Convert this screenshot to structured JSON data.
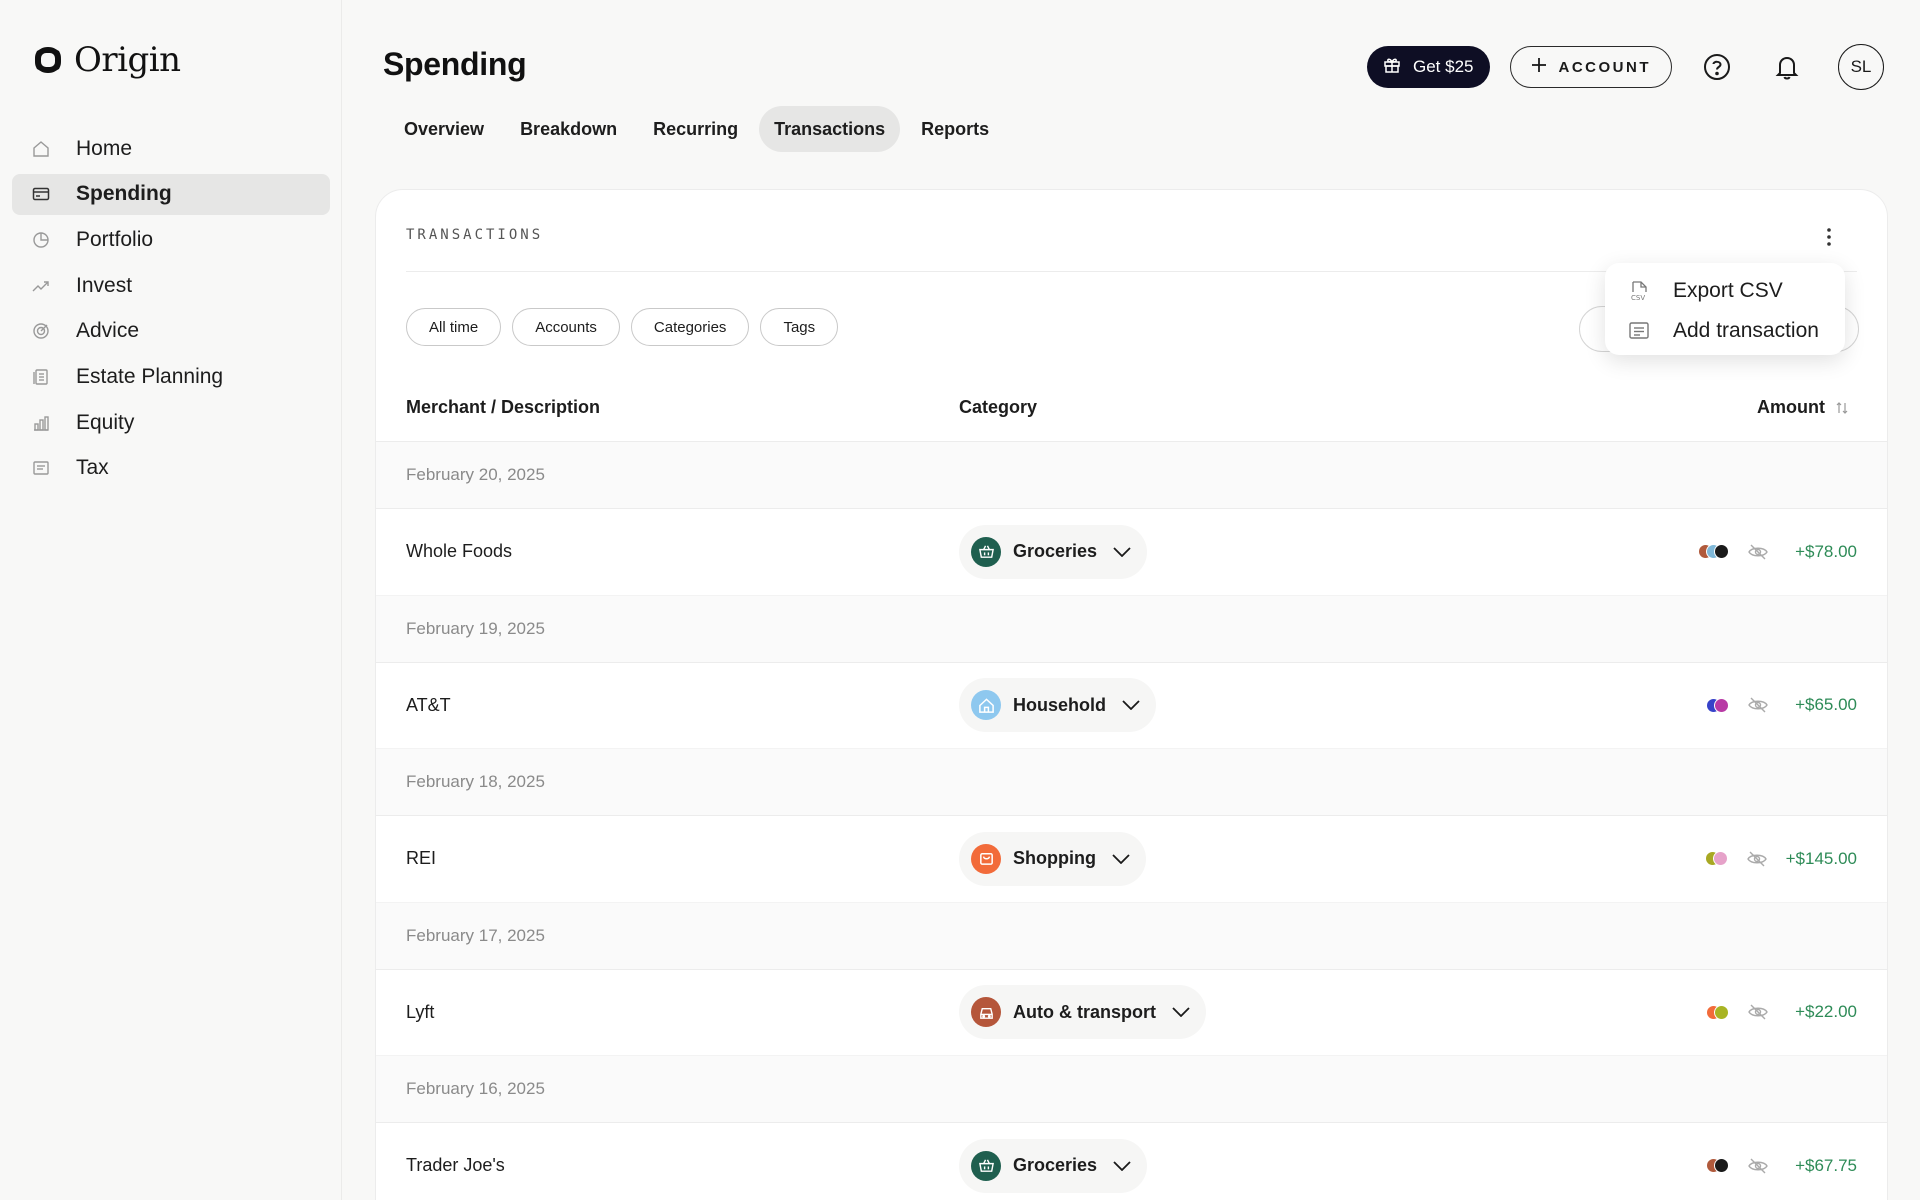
{
  "app": {
    "name": "Origin"
  },
  "sidebar": {
    "items": [
      {
        "label": "Home",
        "icon": "home-icon",
        "active": false
      },
      {
        "label": "Spending",
        "icon": "card-icon",
        "active": true
      },
      {
        "label": "Portfolio",
        "icon": "pie-icon",
        "active": false
      },
      {
        "label": "Invest",
        "icon": "trend-icon",
        "active": false
      },
      {
        "label": "Advice",
        "icon": "target-icon",
        "active": false
      },
      {
        "label": "Estate Planning",
        "icon": "document-icon",
        "active": false
      },
      {
        "label": "Equity",
        "icon": "bar-chart-icon",
        "active": false
      },
      {
        "label": "Tax",
        "icon": "receipt-icon",
        "active": false
      }
    ]
  },
  "header": {
    "title": "Spending",
    "get_label": "Get $25",
    "account_label": "ACCOUNT",
    "avatar_initials": "SL"
  },
  "tabs": [
    {
      "label": "Overview",
      "active": false
    },
    {
      "label": "Breakdown",
      "active": false
    },
    {
      "label": "Recurring",
      "active": false
    },
    {
      "label": "Transactions",
      "active": true
    },
    {
      "label": "Reports",
      "active": false
    }
  ],
  "card": {
    "title": "TRANSACTIONS",
    "filters": [
      "All time",
      "Accounts",
      "Categories",
      "Tags"
    ],
    "columns": {
      "merchant": "Merchant / Description",
      "category": "Category",
      "amount": "Amount"
    }
  },
  "menu": {
    "items": [
      {
        "label": "Export CSV",
        "icon": "csv-file-icon"
      },
      {
        "label": "Add transaction",
        "icon": "add-transaction-icon"
      }
    ]
  },
  "groups": [
    {
      "date": "February 20, 2025",
      "merchant": "Whole Foods",
      "category": "Groceries",
      "cat_icon": "basket-icon",
      "cat_color": "#1f5f4f",
      "dots": [
        "#b05a3c",
        "#7fb8d8",
        "#1a1a1a"
      ],
      "amount": "+$78.00"
    },
    {
      "date": "February 19, 2025",
      "merchant": "AT&T",
      "category": "Household",
      "cat_icon": "house-icon",
      "cat_color": "#8ec8ef",
      "dots": [
        "#3742c9",
        "#b83aa5"
      ],
      "amount": "+$65.00"
    },
    {
      "date": "February 18, 2025",
      "merchant": "REI",
      "category": "Shopping",
      "cat_icon": "bag-icon",
      "cat_color": "#f26b3a",
      "dots": [
        "#a8a823",
        "#e6a2c9"
      ],
      "amount": "+$145.00"
    },
    {
      "date": "February 17, 2025",
      "merchant": "Lyft",
      "category": "Auto & transport",
      "cat_icon": "car-icon",
      "cat_color": "#b5563a",
      "dots": [
        "#f26b3a",
        "#a8b423"
      ],
      "amount": "+$22.00"
    },
    {
      "date": "February 16, 2025",
      "merchant": "Trader Joe's",
      "category": "Groceries",
      "cat_icon": "basket-icon",
      "cat_color": "#1f5f4f",
      "dots": [
        "#b05a3c",
        "#1a1a1a"
      ],
      "amount": "+$67.75"
    }
  ]
}
